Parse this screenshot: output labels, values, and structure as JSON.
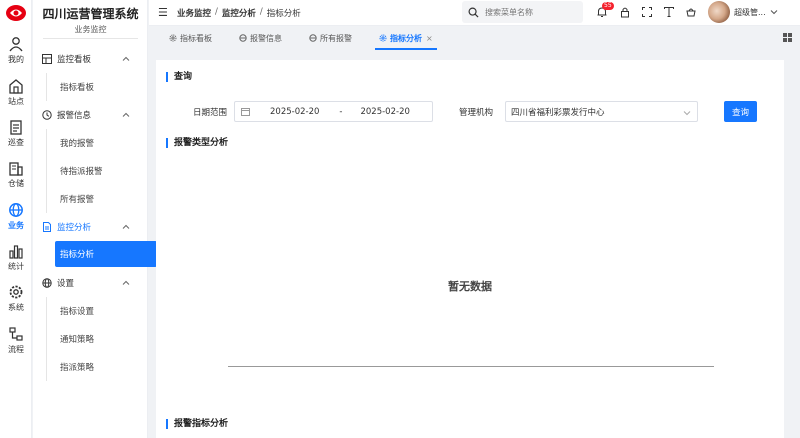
{
  "app": {
    "title": "四川运营管理系统",
    "subtitle": "业务监控"
  },
  "rail": [
    {
      "label": "我的",
      "icon": "user-icon"
    },
    {
      "label": "站点",
      "icon": "building-icon"
    },
    {
      "label": "巡查",
      "icon": "clipboard-icon"
    },
    {
      "label": "仓储",
      "icon": "warehouse-icon"
    },
    {
      "label": "业务",
      "icon": "globe-icon",
      "active": true
    },
    {
      "label": "统计",
      "icon": "bar-chart-icon"
    },
    {
      "label": "系统",
      "icon": "gear-icon"
    },
    {
      "label": "流程",
      "icon": "flow-icon"
    }
  ],
  "menu": {
    "groups": [
      {
        "label": "监控看板",
        "icon": "dashboard-icon",
        "items": [
          "指标看板"
        ]
      },
      {
        "label": "报警信息",
        "icon": "alarm-icon",
        "items": [
          "我的报警",
          "待指派报警",
          "所有报警"
        ]
      },
      {
        "label": "监控分析",
        "icon": "document-icon",
        "items": [
          "指标分析"
        ],
        "active": true
      },
      {
        "label": "设置",
        "icon": "globe-icon",
        "items": [
          "指标设置",
          "通知策略",
          "指派策略"
        ]
      }
    ]
  },
  "header": {
    "breadcrumb": [
      "业务监控",
      "监控分析",
      "指标分析"
    ],
    "search_placeholder": "搜索菜单名称",
    "notification_count": "55",
    "user_name": "超级管..."
  },
  "tabs": [
    {
      "label": "指标看板"
    },
    {
      "label": "报警信息"
    },
    {
      "label": "所有报警"
    },
    {
      "label": "指标分析",
      "active": true,
      "close": "×"
    }
  ],
  "query": {
    "title": "查询",
    "date_label": "日期范围",
    "date_start": "2025-02-20",
    "date_sep": "-",
    "date_end": "2025-02-20",
    "org_label": "管理机构",
    "org_value": "四川省福利彩票发行中心",
    "button": "查询"
  },
  "alarm_type": {
    "title": "报警类型分析",
    "empty_text": "暂无数据"
  },
  "alarm_metric": {
    "title": "报警指标分析"
  },
  "colors": {
    "accent": "#1677ff",
    "badge": "#f5222d",
    "logo": "#e60012"
  }
}
